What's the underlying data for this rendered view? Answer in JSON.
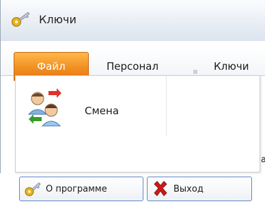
{
  "window": {
    "title": "Ключи",
    "icon": "key-icon"
  },
  "ribbon": {
    "file_tab_label": "Файл",
    "tabs": [
      {
        "label": "Персонал"
      },
      {
        "label": "Ключи"
      }
    ]
  },
  "file_menu": {
    "items": [
      {
        "label": "Смена",
        "icon": "swap-users-icon"
      }
    ],
    "buttons": {
      "about_label": "О программе",
      "about_icon": "key-icon",
      "exit_label": "Выход",
      "exit_icon": "close-icon"
    }
  },
  "partial_text": "а",
  "colors": {
    "file_tab": "#f08c1e",
    "button_border": "#5f86c2",
    "exit_icon": "#d01818"
  }
}
